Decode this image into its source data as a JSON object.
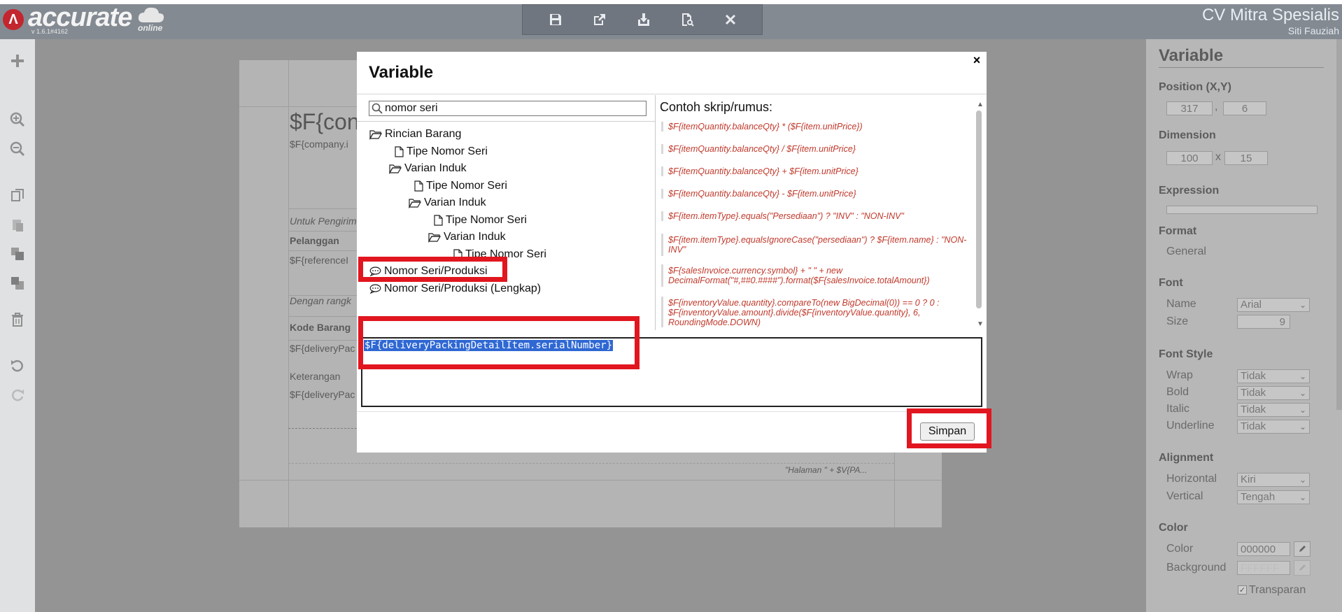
{
  "header": {
    "logo_text": "accurate",
    "logo_sub": "online",
    "version": "v 1.6.1#4162",
    "company": "CV Mitra Spesialis",
    "user": "Siti Fauziah",
    "toolbar_icons": [
      "save-icon",
      "export-icon",
      "import-icon",
      "preview-icon",
      "close-icon"
    ]
  },
  "left_tools": [
    "add-icon",
    "zoom-in-icon",
    "zoom-out-icon",
    "copy-icon",
    "paste-icon",
    "bring-front-icon",
    "send-back-icon",
    "delete-icon",
    "undo-icon",
    "redo-icon"
  ],
  "document": {
    "company_field": "$F{con",
    "company_info": "$F{company.i",
    "untuk_pengiriman": "Untuk Pengirim",
    "pelanggan": "Pelanggan",
    "reference": "$F{referenceI",
    "dengan_rangkaian": "Dengan rangk",
    "kode_barang": "Kode Barang",
    "delivery_field_1": "$F{deliveryPac",
    "keterangan": "Keterangan",
    "delivery_field_2": "$F{deliveryPac",
    "page_footer": "\"Halaman \" + $V{PA..."
  },
  "modal": {
    "title": "Variable",
    "close_label": "×",
    "search": {
      "value": "nomor seri",
      "placeholder": ""
    },
    "tree": [
      {
        "label": "Rincian Barang",
        "type": "folder",
        "level": 0
      },
      {
        "label": "Tipe Nomor Seri",
        "type": "file",
        "level": 1
      },
      {
        "label": "Varian Induk",
        "type": "folder",
        "level": 1
      },
      {
        "label": "Tipe Nomor Seri",
        "type": "file",
        "level": 2
      },
      {
        "label": "Varian Induk",
        "type": "folder",
        "level": 2
      },
      {
        "label": "Tipe Nomor Seri",
        "type": "file",
        "level": 3
      },
      {
        "label": "Varian Induk",
        "type": "folder",
        "level": 3
      },
      {
        "label": "Tipe Nomor Seri",
        "type": "file",
        "level": 4
      },
      {
        "label": "Nomor Seri/Produksi",
        "type": "comment",
        "level": 0
      },
      {
        "label": "Nomor Seri/Produksi (Lengkap)",
        "type": "comment",
        "level": 0
      }
    ],
    "examples_title": "Contoh skrip/rumus:",
    "examples": [
      "$F{itemQuantity.balanceQty} * ($F{item.unitPrice})",
      "$F{itemQuantity.balanceQty} / $F{item.unitPrice}",
      "$F{itemQuantity.balanceQty} + $F{item.unitPrice}",
      "$F{itemQuantity.balanceQty} - $F{item.unitPrice}",
      "$F{item.itemType}.equals(\"Persediaan\") ? \"INV\" : \"NON-INV\"",
      "$F{item.itemType}.equalsIgnoreCase(\"persediaan\") ? $F{item.name} : \"NON-INV\"",
      "$F{salesInvoice.currency.symbol} + \" \" + new DecimalFormat(\"#,##0.####\").format($F{salesInvoice.totalAmount})",
      "$F{inventoryValue.quantity}.compareTo(new BigDecimal(0)) == 0 ? 0 : $F{inventoryValue.amount}.divide($F{inventoryValue.quantity}, 6, RoundingMode.DOWN)"
    ],
    "expression": "$F{deliveryPackingDetailItem.serialNumber}",
    "save_label": "Simpan"
  },
  "panel": {
    "title": "Variable",
    "position_label": "Position (X,Y)",
    "pos_x": "317",
    "pos_y": "6",
    "comma": ",",
    "dimension_label": "Dimension",
    "dim_w": "100",
    "dim_x": "x",
    "dim_h": "15",
    "expression_label": "Expression",
    "format_label": "Format",
    "format_value": "General",
    "font_label": "Font",
    "name_label": "Name",
    "name_value": "Arial",
    "size_label": "Size",
    "size_value": "9",
    "font_style_label": "Font Style",
    "wrap_label": "Wrap",
    "wrap_value": "Tidak",
    "bold_label": "Bold",
    "bold_value": "Tidak",
    "italic_label": "Italic",
    "italic_value": "Tidak",
    "underline_label": "Underline",
    "underline_value": "Tidak",
    "alignment_label": "Alignment",
    "horizontal_label": "Horizontal",
    "horizontal_value": "Kiri",
    "vertical_label": "Vertical",
    "vertical_value": "Tengah",
    "color_label": "Color",
    "color_field_label": "Color",
    "color_value": "000000",
    "background_label": "Background",
    "background_value": "FFFFFF",
    "transparent_label": "Transparan"
  },
  "colors": {
    "highlight": "#e1161f",
    "example_text": "#c0392b",
    "selection": "#2f68d3",
    "brand": "#c3262e"
  }
}
